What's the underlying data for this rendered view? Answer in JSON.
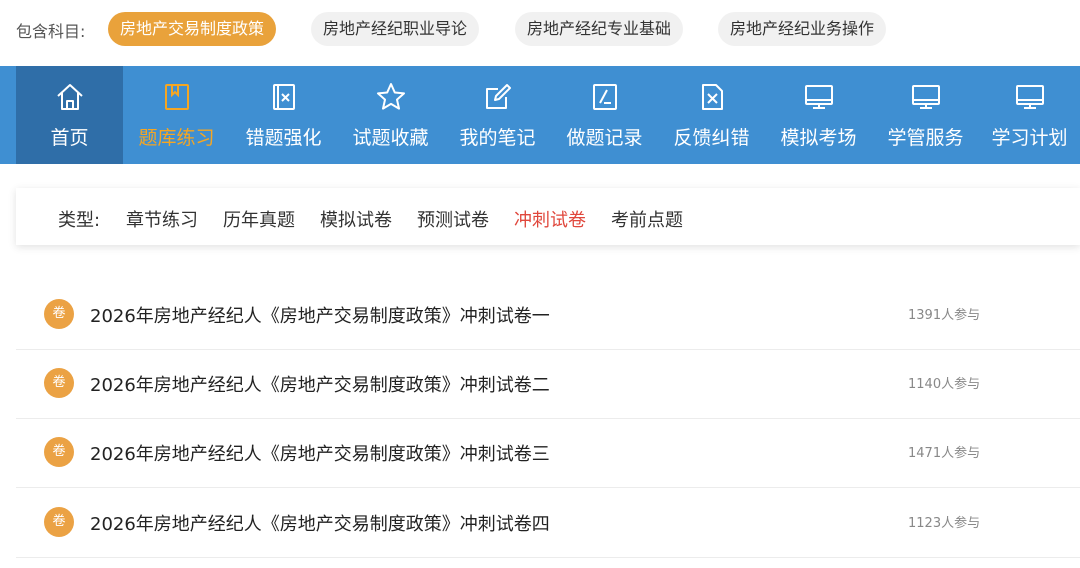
{
  "subjects": {
    "label": "包含科目:",
    "items": [
      {
        "label": "房地产交易制度政策",
        "active": true
      },
      {
        "label": "房地产经纪职业导论",
        "active": false
      },
      {
        "label": "房地产经纪专业基础",
        "active": false
      },
      {
        "label": "房地产经纪业务操作",
        "active": false
      }
    ]
  },
  "nav": {
    "items": [
      {
        "label": "首页",
        "icon": "home-icon"
      },
      {
        "label": "题库练习",
        "icon": "book-icon"
      },
      {
        "label": "错题强化",
        "icon": "wrong-question-icon"
      },
      {
        "label": "试题收藏",
        "icon": "star-icon"
      },
      {
        "label": "我的笔记",
        "icon": "note-edit-icon"
      },
      {
        "label": "做题记录",
        "icon": "record-icon"
      },
      {
        "label": "反馈纠错",
        "icon": "feedback-x-icon"
      },
      {
        "label": "模拟考场",
        "icon": "monitor-icon"
      },
      {
        "label": "学管服务",
        "icon": "monitor-icon"
      },
      {
        "label": "学习计划",
        "icon": "monitor-icon"
      }
    ],
    "active_index": 1,
    "colors": {
      "bar": "#3f8fd2",
      "home_bg": "#2f6ea8",
      "active_text": "#f5a623"
    }
  },
  "types": {
    "label": "类型:",
    "items": [
      "章节练习",
      "历年真题",
      "模拟试卷",
      "预测试卷",
      "冲刺试卷",
      "考前点题"
    ],
    "active_index": 4
  },
  "papers": [
    {
      "badge": "卷",
      "title": "2026年房地产经纪人《房地产交易制度政策》冲刺试卷一",
      "participants": "1391人参与"
    },
    {
      "badge": "卷",
      "title": "2026年房地产经纪人《房地产交易制度政策》冲刺试卷二",
      "participants": "1140人参与"
    },
    {
      "badge": "卷",
      "title": "2026年房地产经纪人《房地产交易制度政策》冲刺试卷三",
      "participants": "1471人参与"
    },
    {
      "badge": "卷",
      "title": "2026年房地产经纪人《房地产交易制度政策》冲刺试卷四",
      "participants": "1123人参与"
    }
  ]
}
